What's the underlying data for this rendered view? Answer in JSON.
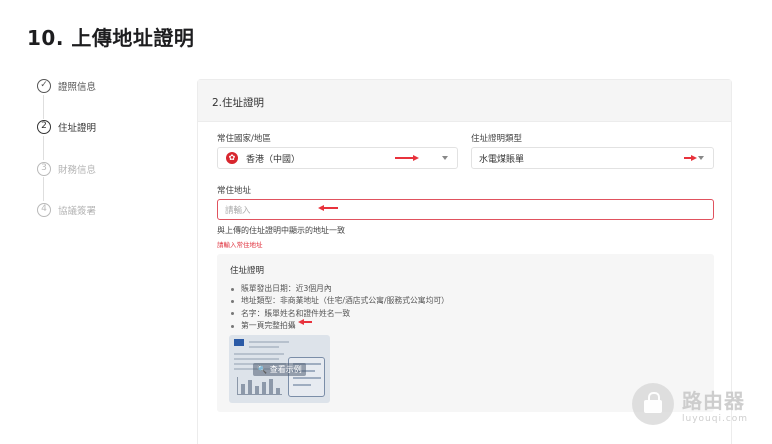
{
  "page": {
    "title": "10. 上傳地址證明"
  },
  "steps": [
    {
      "index": "✓",
      "label": "證照信息",
      "state": "done"
    },
    {
      "index": "2",
      "label": "住址證明",
      "state": "current"
    },
    {
      "index": "3",
      "label": "財務信息",
      "state": "pending"
    },
    {
      "index": "4",
      "label": "協議簽署",
      "state": "pending"
    }
  ],
  "card": {
    "title": "2.住址證明"
  },
  "form": {
    "country": {
      "label": "常住國家/地區",
      "value": "香港（中國）"
    },
    "proof_type": {
      "label": "住址證明類型",
      "value": "水電煤賬單"
    },
    "address": {
      "label": "常住地址",
      "placeholder": "請輸入",
      "hint": "與上傳的住址證明中顯示的地址一致",
      "error": "請輸入常住地址"
    }
  },
  "info": {
    "title": "住址證明",
    "items": [
      "賬單發出日期：近3個月內",
      "地址類型：非商業地址（住宅/酒店式公寓/服務式公寓均可）",
      "名字：賬單姓名和證件姓名一致",
      "第一頁完整拍攝"
    ],
    "sample_zoom_label": "查看示例"
  },
  "watermark": {
    "name": "路由器",
    "domain": "luyouqi.com"
  },
  "colors": {
    "accent_red": "#e8323c",
    "error_border": "#e0525e",
    "flag_red": "#d8262e"
  }
}
